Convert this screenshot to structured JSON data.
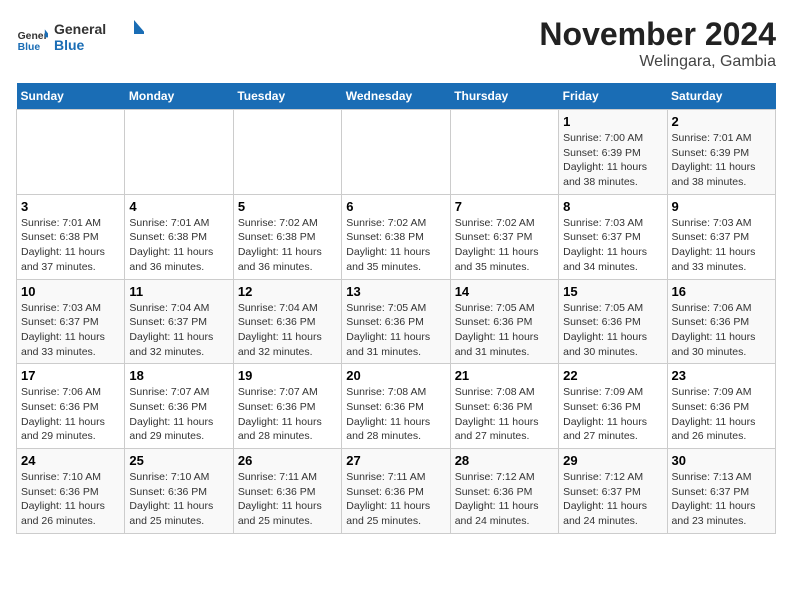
{
  "logo": {
    "text_general": "General",
    "text_blue": "Blue"
  },
  "title": "November 2024",
  "subtitle": "Welingara, Gambia",
  "days_of_week": [
    "Sunday",
    "Monday",
    "Tuesday",
    "Wednesday",
    "Thursday",
    "Friday",
    "Saturday"
  ],
  "weeks": [
    [
      {
        "day": "",
        "info": ""
      },
      {
        "day": "",
        "info": ""
      },
      {
        "day": "",
        "info": ""
      },
      {
        "day": "",
        "info": ""
      },
      {
        "day": "",
        "info": ""
      },
      {
        "day": "1",
        "info": "Sunrise: 7:00 AM\nSunset: 6:39 PM\nDaylight: 11 hours and 38 minutes."
      },
      {
        "day": "2",
        "info": "Sunrise: 7:01 AM\nSunset: 6:39 PM\nDaylight: 11 hours and 38 minutes."
      }
    ],
    [
      {
        "day": "3",
        "info": "Sunrise: 7:01 AM\nSunset: 6:38 PM\nDaylight: 11 hours and 37 minutes."
      },
      {
        "day": "4",
        "info": "Sunrise: 7:01 AM\nSunset: 6:38 PM\nDaylight: 11 hours and 36 minutes."
      },
      {
        "day": "5",
        "info": "Sunrise: 7:02 AM\nSunset: 6:38 PM\nDaylight: 11 hours and 36 minutes."
      },
      {
        "day": "6",
        "info": "Sunrise: 7:02 AM\nSunset: 6:38 PM\nDaylight: 11 hours and 35 minutes."
      },
      {
        "day": "7",
        "info": "Sunrise: 7:02 AM\nSunset: 6:37 PM\nDaylight: 11 hours and 35 minutes."
      },
      {
        "day": "8",
        "info": "Sunrise: 7:03 AM\nSunset: 6:37 PM\nDaylight: 11 hours and 34 minutes."
      },
      {
        "day": "9",
        "info": "Sunrise: 7:03 AM\nSunset: 6:37 PM\nDaylight: 11 hours and 33 minutes."
      }
    ],
    [
      {
        "day": "10",
        "info": "Sunrise: 7:03 AM\nSunset: 6:37 PM\nDaylight: 11 hours and 33 minutes."
      },
      {
        "day": "11",
        "info": "Sunrise: 7:04 AM\nSunset: 6:37 PM\nDaylight: 11 hours and 32 minutes."
      },
      {
        "day": "12",
        "info": "Sunrise: 7:04 AM\nSunset: 6:36 PM\nDaylight: 11 hours and 32 minutes."
      },
      {
        "day": "13",
        "info": "Sunrise: 7:05 AM\nSunset: 6:36 PM\nDaylight: 11 hours and 31 minutes."
      },
      {
        "day": "14",
        "info": "Sunrise: 7:05 AM\nSunset: 6:36 PM\nDaylight: 11 hours and 31 minutes."
      },
      {
        "day": "15",
        "info": "Sunrise: 7:05 AM\nSunset: 6:36 PM\nDaylight: 11 hours and 30 minutes."
      },
      {
        "day": "16",
        "info": "Sunrise: 7:06 AM\nSunset: 6:36 PM\nDaylight: 11 hours and 30 minutes."
      }
    ],
    [
      {
        "day": "17",
        "info": "Sunrise: 7:06 AM\nSunset: 6:36 PM\nDaylight: 11 hours and 29 minutes."
      },
      {
        "day": "18",
        "info": "Sunrise: 7:07 AM\nSunset: 6:36 PM\nDaylight: 11 hours and 29 minutes."
      },
      {
        "day": "19",
        "info": "Sunrise: 7:07 AM\nSunset: 6:36 PM\nDaylight: 11 hours and 28 minutes."
      },
      {
        "day": "20",
        "info": "Sunrise: 7:08 AM\nSunset: 6:36 PM\nDaylight: 11 hours and 28 minutes."
      },
      {
        "day": "21",
        "info": "Sunrise: 7:08 AM\nSunset: 6:36 PM\nDaylight: 11 hours and 27 minutes."
      },
      {
        "day": "22",
        "info": "Sunrise: 7:09 AM\nSunset: 6:36 PM\nDaylight: 11 hours and 27 minutes."
      },
      {
        "day": "23",
        "info": "Sunrise: 7:09 AM\nSunset: 6:36 PM\nDaylight: 11 hours and 26 minutes."
      }
    ],
    [
      {
        "day": "24",
        "info": "Sunrise: 7:10 AM\nSunset: 6:36 PM\nDaylight: 11 hours and 26 minutes."
      },
      {
        "day": "25",
        "info": "Sunrise: 7:10 AM\nSunset: 6:36 PM\nDaylight: 11 hours and 25 minutes."
      },
      {
        "day": "26",
        "info": "Sunrise: 7:11 AM\nSunset: 6:36 PM\nDaylight: 11 hours and 25 minutes."
      },
      {
        "day": "27",
        "info": "Sunrise: 7:11 AM\nSunset: 6:36 PM\nDaylight: 11 hours and 25 minutes."
      },
      {
        "day": "28",
        "info": "Sunrise: 7:12 AM\nSunset: 6:36 PM\nDaylight: 11 hours and 24 minutes."
      },
      {
        "day": "29",
        "info": "Sunrise: 7:12 AM\nSunset: 6:37 PM\nDaylight: 11 hours and 24 minutes."
      },
      {
        "day": "30",
        "info": "Sunrise: 7:13 AM\nSunset: 6:37 PM\nDaylight: 11 hours and 23 minutes."
      }
    ]
  ]
}
